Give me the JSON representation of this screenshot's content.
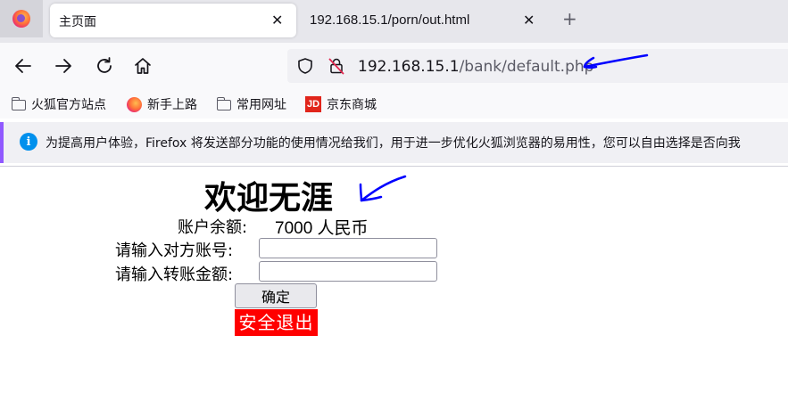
{
  "browser": {
    "tabs": [
      {
        "title": "主页面",
        "active": true
      },
      {
        "title": "192.168.15.1/porn/out.html",
        "active": false
      }
    ],
    "new_tab_label": "+",
    "url": {
      "host": "192.168.15.1",
      "path": "/bank/default.php"
    },
    "bookmarks": [
      {
        "label": "火狐官方站点",
        "icon": "folder-icon"
      },
      {
        "label": "新手上路",
        "icon": "firefox-icon"
      },
      {
        "label": "常用网址",
        "icon": "folder-icon"
      },
      {
        "label": "京东商城",
        "icon": "jd-icon"
      }
    ],
    "jd_icon_text": "JD",
    "notification": "为提高用户体验，Firefox 将发送部分功能的使用情况给我们，用于进一步优化火狐浏览器的易用性，您可以自由选择是否向我",
    "notification_icon_text": "i"
  },
  "page": {
    "title": "欢迎无涯",
    "balance_label": "账户余额:",
    "balance_value": "7000 人民币",
    "account_label": "请输入对方账号:",
    "account_value": "",
    "amount_label": "请输入转账金额:",
    "amount_value": "",
    "confirm_label": "确定",
    "logout_label": "安全退出"
  },
  "colors": {
    "accent": "#9059ff",
    "info": "#0090ed",
    "logout_bg": "#ff0000",
    "annotation": "#0000ff"
  }
}
